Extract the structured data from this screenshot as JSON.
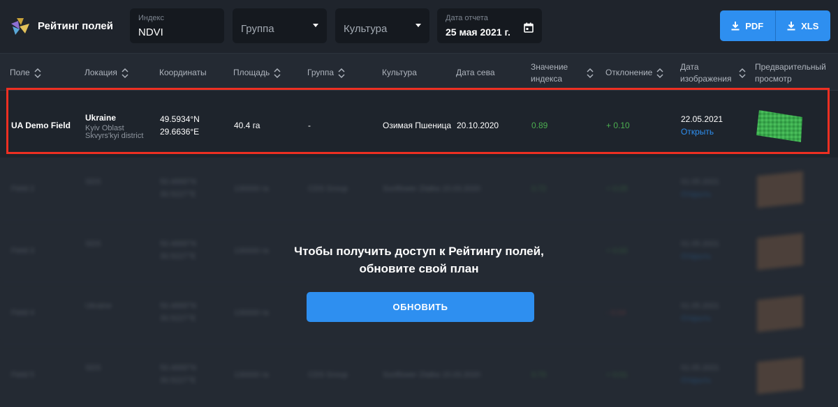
{
  "app": {
    "title": "Рейтинг полей"
  },
  "filters": {
    "index": {
      "label": "Индекс",
      "value": "NDVI"
    },
    "group": {
      "placeholder": "Группа"
    },
    "crop": {
      "placeholder": "Культура"
    },
    "report_date": {
      "label": "Дата отчета",
      "value": "25 мая 2021 г."
    }
  },
  "export": {
    "pdf_label": "PDF",
    "xls_label": "XLS"
  },
  "table": {
    "columns": {
      "field": "Поле",
      "location": "Локация",
      "coordinates": "Координаты",
      "area": "Площадь",
      "group": "Группа",
      "crop": "Культура",
      "sow_date": "Дата сева",
      "index_value_1": "Значение",
      "index_value_2": "индекса",
      "deviation": "Отклонение",
      "image_date_1": "Дата",
      "image_date_2": "изображения",
      "preview_1": "Предварительный",
      "preview_2": "просмотр"
    },
    "row": {
      "field": "UA Demo Field",
      "country": "Ukraine",
      "oblast": "Kyiv Oblast",
      "district": "Skvyrs'kyi district",
      "lat": "49.5934°N",
      "lon": "29.6636°E",
      "area": "40.4 га",
      "group": "-",
      "crop": "Озимая Пшеница",
      "sow_date": "20.10.2020",
      "index_value": "0.89",
      "deviation": "+ 0.10",
      "image_date": "22.05.2021",
      "open_link": "Открыть"
    },
    "blurred_rows": [
      {
        "field": "Field 2",
        "location": "SDS",
        "lat": "50.4669°N",
        "lon": "30.5227°E",
        "area": "130000 га",
        "group": "CDS Group",
        "crop_date": "Sunflower Zlatka 15.03.2020",
        "index": "0.72",
        "dev": "+ 0.05",
        "date": "01.05.2021",
        "open": "Открыть"
      },
      {
        "field": "Field 3",
        "location": "SDS",
        "lat": "50.4669°N",
        "lon": "30.5227°E",
        "area": "130000 га",
        "group": "",
        "crop_date": "",
        "index": "",
        "dev": "+ 0.02",
        "date": "01.05.2021",
        "open": "Открыть"
      },
      {
        "field": "Field 4",
        "location": "Ukraine",
        "lat": "50.4669°N",
        "lon": "30.5227°E",
        "area": "130000 га",
        "group": "",
        "crop_date": "",
        "index": "",
        "dev": "- 0.04",
        "date": "01.05.2021",
        "open": "Открыть"
      },
      {
        "field": "Field 5",
        "location": "SDS",
        "lat": "50.4669°N",
        "lon": "30.5227°E",
        "area": "130000 га",
        "group": "CDS Group",
        "crop_date": "Sunflower Zlatka 15.03.2020",
        "index": "0.70",
        "dev": "+ 0.01",
        "date": "01.05.2021",
        "open": "Открыть"
      }
    ]
  },
  "upgrade": {
    "line1": "Чтобы получить доступ к Рейтингу полей,",
    "line2": "обновите свой план",
    "button": "ОБНОВИТЬ"
  },
  "colors": {
    "accent": "#2e8ff0",
    "highlight": "#ee2f22",
    "positive": "#4caf50",
    "background": "#242a33"
  }
}
